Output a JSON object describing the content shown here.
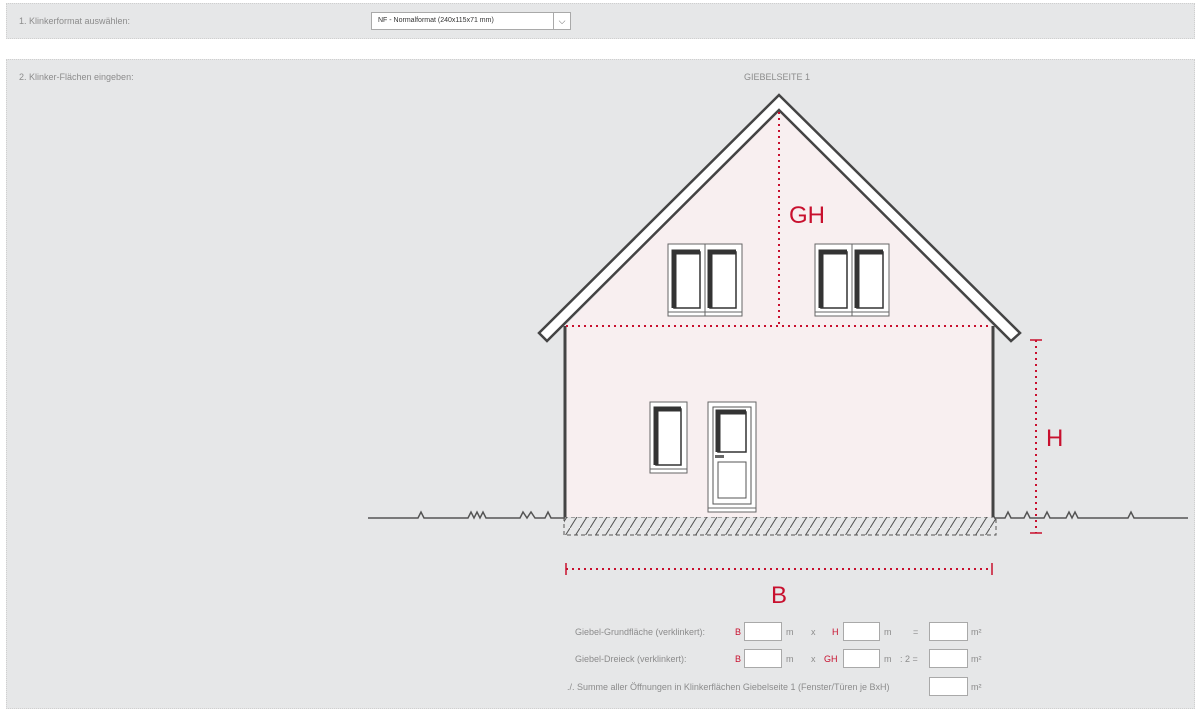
{
  "step1": {
    "label": "1. Klinkerformat auswählen:",
    "select_value": "NF - Normalformat (240x115x71 mm)",
    "arrow_glyph": "⌵"
  },
  "step2": {
    "label": "2. Klinker-Flächen eingeben:",
    "gable_title": "GIEBELSEITE 1"
  },
  "diagram": {
    "label_gh": "GH",
    "label_h": "H",
    "label_b": "B",
    "accent_color": "#c8102e"
  },
  "form": {
    "row1": {
      "label": "Giebel-Grundfläche (verklinkert):",
      "var1": "B",
      "unit1": "m",
      "op1": "x",
      "var2": "H",
      "unit2": "m",
      "op2": "=",
      "unit3": "m²"
    },
    "row2": {
      "label": "Giebel-Dreieck (verklinkert):",
      "var1": "B",
      "unit1": "m",
      "op1": "x",
      "var2": "GH",
      "unit2": "m",
      "op2": ": 2 =",
      "unit3": "m²"
    },
    "row3": {
      "label": "./. Summe aller Öffnungen in Klinkerflächen Giebelseite 1 (Fenster/Türen je BxH)",
      "unit": "m²"
    }
  }
}
